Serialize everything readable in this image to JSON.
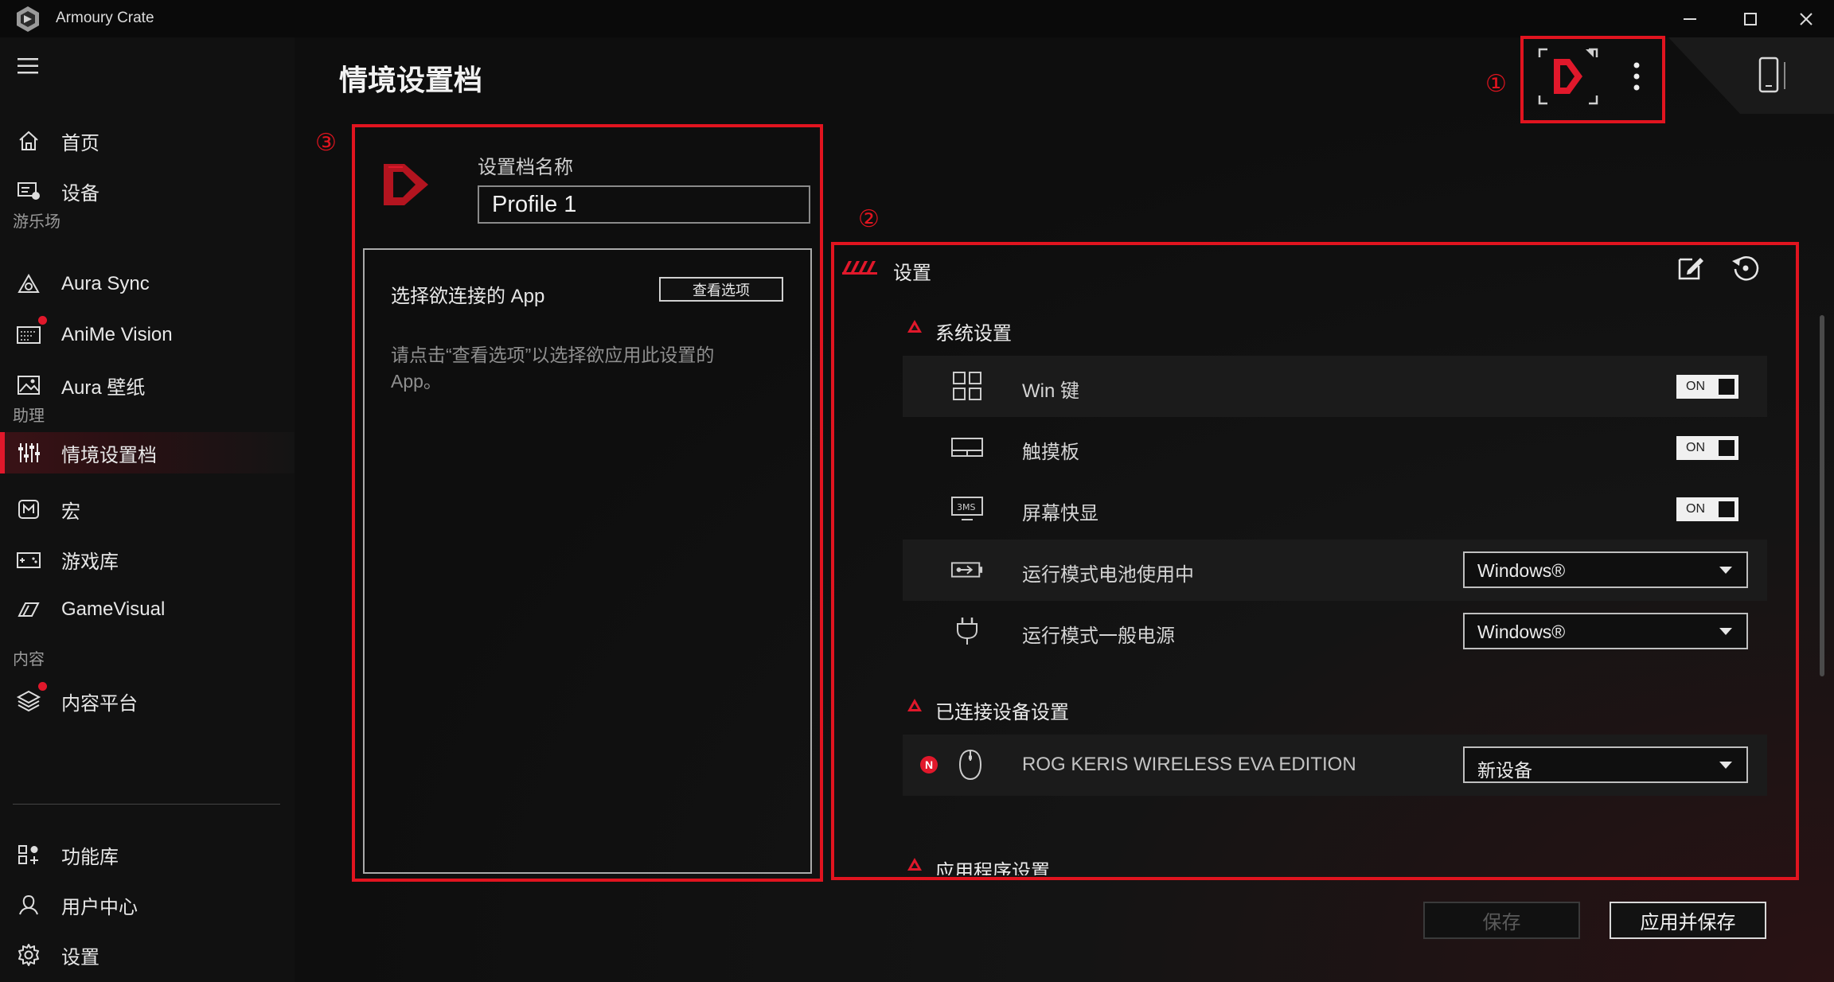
{
  "app": {
    "title": "Armoury Crate",
    "window_controls": {
      "minimize": "—",
      "maximize": "☐",
      "close": "✕"
    }
  },
  "sidebar": {
    "items": [
      {
        "label": "首页",
        "icon": "home-icon"
      },
      {
        "label": "设备",
        "icon": "device-icon"
      },
      {
        "label": "Aura Sync",
        "icon": "aura-sync-icon"
      },
      {
        "label": "AniMe Vision",
        "icon": "anime-vision-icon",
        "badge": true
      },
      {
        "label": "Aura 壁纸",
        "icon": "wallpaper-icon"
      },
      {
        "label": "情境设置档",
        "icon": "sliders-icon",
        "active": true
      },
      {
        "label": "宏",
        "icon": "macro-icon"
      },
      {
        "label": "游戏库",
        "icon": "game-library-icon"
      },
      {
        "label": "GameVisual",
        "icon": "gamevisual-icon"
      },
      {
        "label": "内容平台",
        "icon": "layers-icon",
        "badge": true
      }
    ],
    "sections": {
      "playground": "游乐场",
      "assistant": "助理",
      "content": "内容"
    },
    "bottom_items": [
      {
        "label": "功能库",
        "icon": "feature-library-icon"
      },
      {
        "label": "用户中心",
        "icon": "user-center-icon"
      },
      {
        "label": "设置",
        "icon": "gear-icon"
      }
    ]
  },
  "page": {
    "title": "情境设置档",
    "annotations": {
      "one": "①",
      "two": "②",
      "three": "③"
    }
  },
  "profile": {
    "name_label": "设置档名称",
    "name_value": "Profile 1",
    "app_box_title": "选择欲连接的 App",
    "view_options_button": "查看选项",
    "hint": "请点击“查看选项”以选择欲应用此设置的App。"
  },
  "settings": {
    "title": "设置",
    "system_section": "系统设置",
    "rows": [
      {
        "label": "Win 键",
        "icon": "windows-key-icon",
        "type": "toggle",
        "value": "ON"
      },
      {
        "label": "触摸板",
        "icon": "touchpad-icon",
        "type": "toggle",
        "value": "ON"
      },
      {
        "label": "屏幕快显",
        "icon": "display-3ms-icon",
        "type": "toggle",
        "value": "ON"
      },
      {
        "label": "运行模式电池使用中",
        "icon": "battery-icon",
        "type": "dropdown",
        "value": "Windows®"
      },
      {
        "label": "运行模式一般电源",
        "icon": "plug-icon",
        "type": "dropdown",
        "value": "Windows®"
      }
    ],
    "connected_section": "已连接设备设置",
    "device": {
      "label": "ROG KERIS WIRELESS EVA EDITION",
      "value": "新设备",
      "badge": "N"
    },
    "app_section": "应用程序设置"
  },
  "footer": {
    "save": "保存",
    "apply_save": "应用并保存"
  },
  "colors": {
    "accent": "#e1182b",
    "annotation": "#e1141f"
  }
}
